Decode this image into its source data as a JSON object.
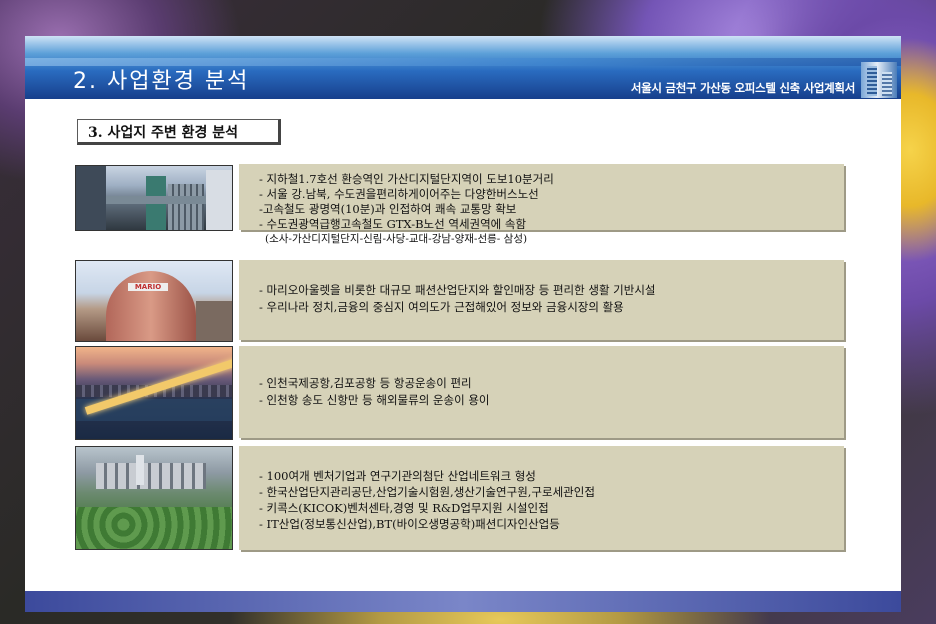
{
  "header": {
    "title": "2. 사업환경 분석",
    "subtitle": "서울시 금천구 가산동 오피스텔 신축 사업계획서"
  },
  "section": {
    "title": "3. 사업지 주변 환경 분석"
  },
  "rows": [
    {
      "lines": [
        "- 지하철1.7호선 환승역인 가산디지털단지역이 도보10분거리",
        "- 서울 강.남북, 수도권을편리하게이어주는 다양한버스노선",
        "-고속철도 광명역(10분)과 인접하여 쾌속 교통망 확보",
        "- 수도권광역급행고속철도 GTX-B노선 역세권역에 속함",
        "  (소사-가산디지털단지-신림-사당-교대-강남-양재-선릉- 삼성)"
      ]
    },
    {
      "photo_sign": "MARIO",
      "lines": [
        "- 마리오아울렛을 비롯한 대규모 패션산업단지와 할인매장 등 편리한 생활 기반시설",
        "- 우리나라 정치,금융의 중심지 여의도가 근접해있어 정보와 금융시장의 활용"
      ]
    },
    {
      "lines": [
        "- 인천국제공항,김포공항 등 항공운송이 편리",
        "- 인천항 송도 신항만 등 해외물류의 운송이 용이"
      ]
    },
    {
      "lines": [
        "- 100여개 벤처기업과 연구기관의첨단 산업네트워크 형성",
        "- 한국산업단지관리공단,산업기술시험원,생산기술연구원,구로세관인접",
        "- 키콕스(KICOK)벤처센타,경영 및 R&D업무지원 시설인접",
        "- IT산업(정보통신산업),BT(바이오생명공학)패션디자인산업등"
      ]
    }
  ]
}
